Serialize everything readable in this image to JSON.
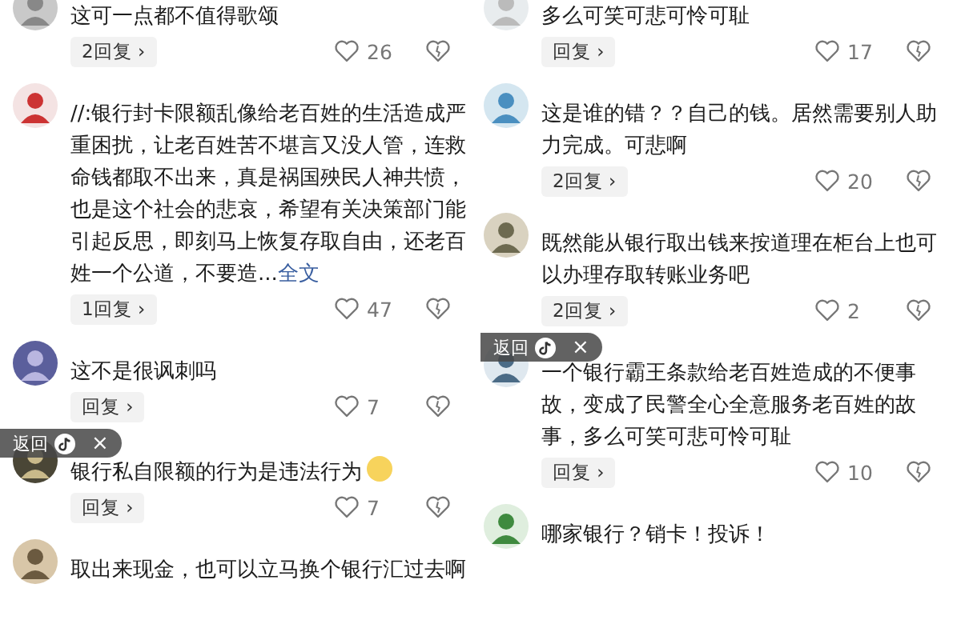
{
  "columns": [
    {
      "comments": [
        {
          "text": "这可一点都不值得歌颂",
          "reply": "2回复 ›",
          "likes": "26"
        },
        {
          "text": "//:银行封卡限额乱像给老百姓的生活造成严重困扰，让老百姓苦不堪言又没人管，连救命钱都取不出来，真是祸国殃民人神共愤，也是这个社会的悲哀，希望有关决策部门能引起反思，即刻马上恢复存取自由，还老百姓一个公道，不要造...",
          "more_link": "全文",
          "reply": "1回复 ›",
          "likes": "47"
        },
        {
          "text": "这不是很讽刺吗",
          "reply": "回复 ›",
          "likes": "7"
        },
        {
          "text": "银行私自限额的行为是违法行为",
          "emoji": true,
          "reply": "回复 ›",
          "likes": "7",
          "back_button": {
            "label": "返回",
            "close": "×"
          }
        },
        {
          "text": "取出来现金，也可以立马换个银行汇过去啊"
        }
      ]
    },
    {
      "comments": [
        {
          "text": "多么可笑可悲可怜可耻",
          "reply": "回复 ›",
          "likes": "17"
        },
        {
          "text": "这是谁的错？？自己的钱。居然需要别人助力完成。可悲啊",
          "reply": "2回复 ›",
          "likes": "20"
        },
        {
          "text": "既然能从银行取出钱来按道理在柜台上也可以办理存取转账业务吧",
          "reply": "2回复 ›",
          "likes": "2"
        },
        {
          "text": "一个银行霸王条款给老百姓造成的不便事故，变成了民警全心全意服务老百姓的故事，多么可笑可悲可怜可耻",
          "reply": "回复 ›",
          "likes": "10",
          "back_button": {
            "label": "返回",
            "close": "×"
          }
        },
        {
          "text": "哪家银行？销卡！投诉！"
        }
      ]
    }
  ]
}
